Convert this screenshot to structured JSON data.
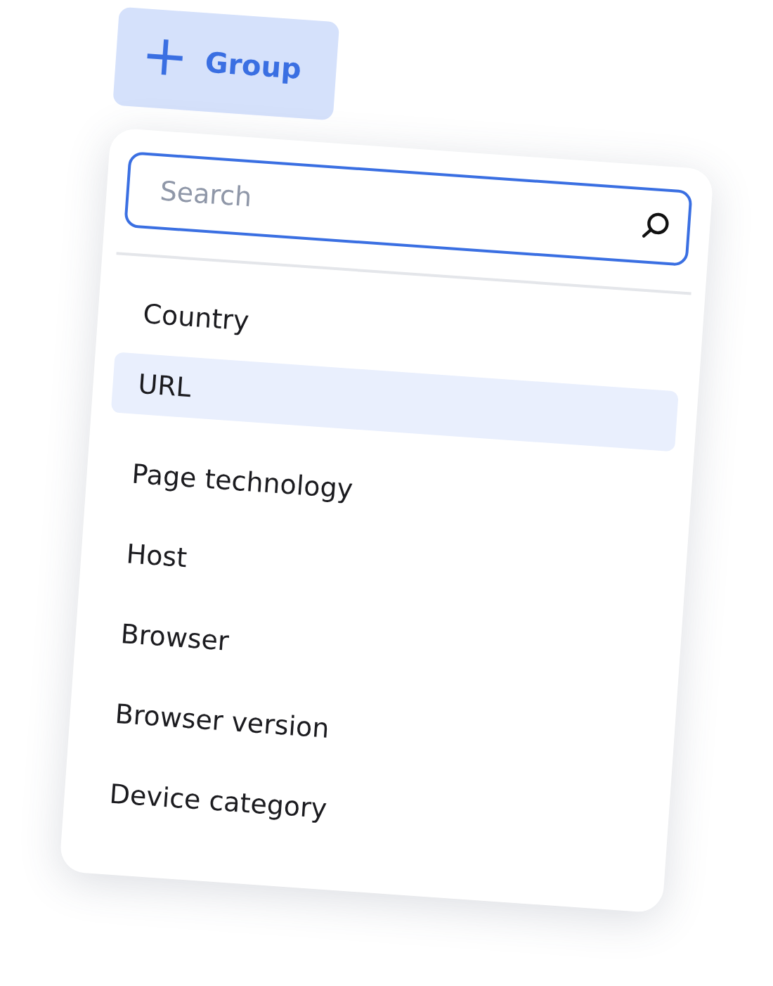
{
  "group_button": {
    "icon": "+",
    "label": "Group"
  },
  "search": {
    "placeholder": "Search"
  },
  "options": [
    {
      "label": "Country",
      "selected": false
    },
    {
      "label": "URL",
      "selected": true
    },
    {
      "label": "Page technology",
      "selected": false
    },
    {
      "label": "Host",
      "selected": false
    },
    {
      "label": "Browser",
      "selected": false
    },
    {
      "label": "Browser version",
      "selected": false
    },
    {
      "label": "Device category",
      "selected": false
    }
  ]
}
